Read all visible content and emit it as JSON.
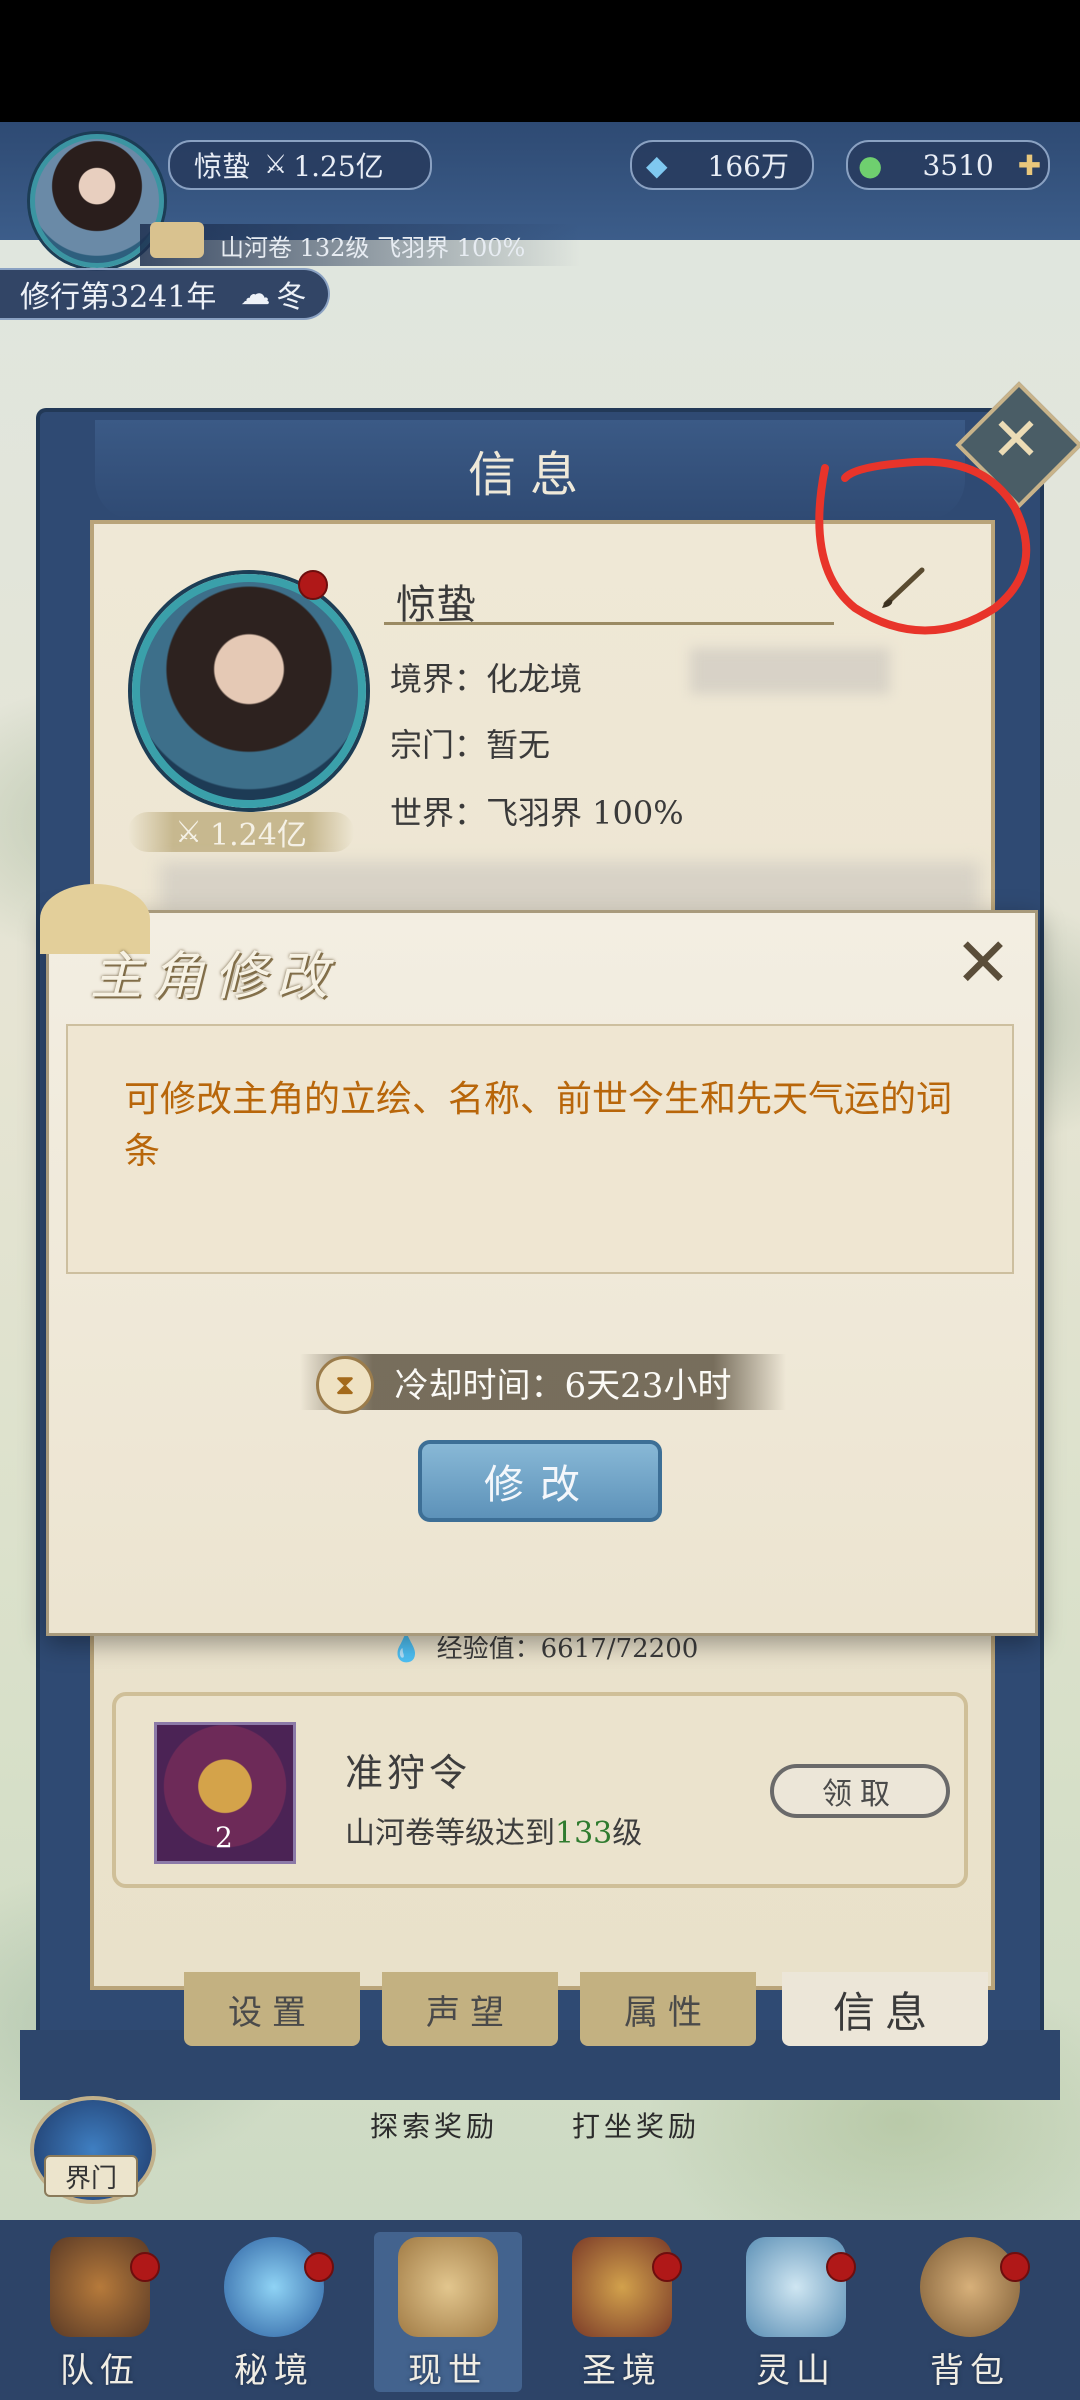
{
  "hud": {
    "player_name": "惊蛰",
    "power": "1.25亿",
    "crystals": "166万",
    "jade": "3510",
    "progress_text": "山河卷 132级 飞羽界 100%",
    "cultivation_year": "修行第3241年",
    "season": "冬"
  },
  "info_panel": {
    "title": "信息",
    "name": "惊蛰",
    "realm": "境界：化龙境",
    "sect": "宗门：暂无",
    "world": "世界：飞羽界  100%",
    "power": "1.24亿",
    "exp": "经验值：6617/72200",
    "reward": {
      "title": "准狩令",
      "desc_prefix": "山河卷等级达到",
      "level": "133",
      "desc_suffix": "级",
      "icon_count": "2",
      "claim": "领取"
    },
    "tabs": [
      "设置",
      "声望",
      "属性",
      "信息"
    ]
  },
  "modal": {
    "title": "主角修改",
    "description": "可修改主角的立绘、名称、前世今生和先天气运的词条",
    "cooldown": "冷却时间：6天23小时",
    "button": "修改"
  },
  "map": {
    "gate_label": "界门",
    "explore_reward": "探索奖励",
    "meditate_reward": "打坐奖励"
  },
  "bottom_nav": [
    {
      "label": "队伍"
    },
    {
      "label": "秘境"
    },
    {
      "label": "现世"
    },
    {
      "label": "圣境"
    },
    {
      "label": "灵山"
    },
    {
      "label": "背包"
    }
  ],
  "colors": {
    "accent": "#b8660a",
    "frame": "#2f4a73",
    "annotation": "#e8342a"
  }
}
